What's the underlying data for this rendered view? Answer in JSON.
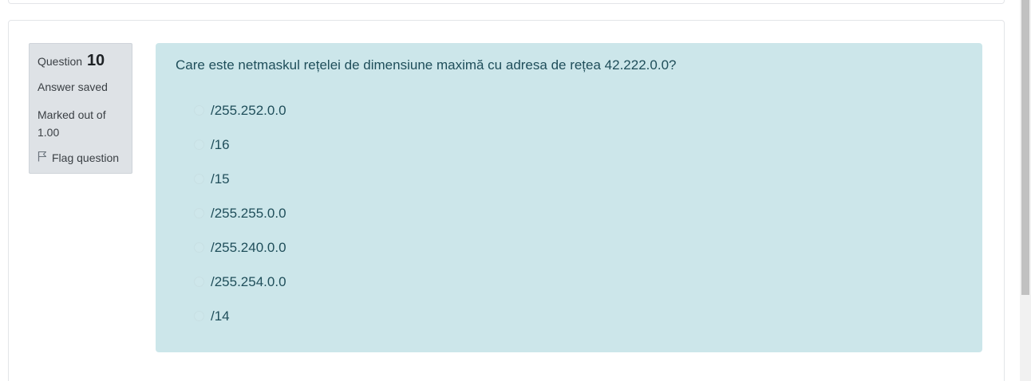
{
  "question": {
    "label": "Question",
    "number": "10",
    "state": "Answer saved",
    "grade": "Marked out of 1.00",
    "flag_label": "Flag question"
  },
  "formulation": {
    "text": "Care este netmaskul rețelei de dimensiune maximă cu adresa de rețea 42.222.0.0?",
    "options": [
      "/255.252.0.0",
      "/16",
      "/15",
      "/255.255.0.0",
      "/255.240.0.0",
      "/255.254.0.0",
      "/14"
    ]
  },
  "colors": {
    "formulation_bg": "#cce6ea",
    "info_bg": "#dee2e6",
    "text": "#1f4e5a"
  },
  "icons": {
    "flag": "flag-icon"
  }
}
